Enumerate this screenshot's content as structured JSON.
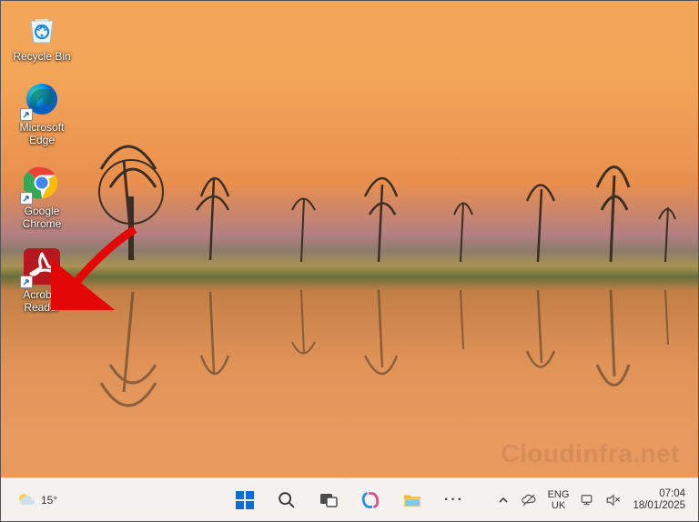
{
  "watermark": "Cloudinfra.net",
  "desktopIcons": {
    "recycleBin": "Recycle Bin",
    "edge": "Microsoft\nEdge",
    "chrome": "Google\nChrome",
    "acrobat": "Acrobat\nReader"
  },
  "taskbar": {
    "weatherTemp": "15°",
    "overflowLabel": "···",
    "lang1": "ENG",
    "lang2": "UK",
    "time": "07:04",
    "date": "18/01/2025"
  },
  "colors": {
    "acrobatRed": "#b6181f",
    "edgeBlue": "#0b7dd1",
    "chromeRed": "#ea4335",
    "chromeGreen": "#34a853",
    "chromeYellow": "#fbbc05",
    "chromeBlue": "#4285f4"
  }
}
